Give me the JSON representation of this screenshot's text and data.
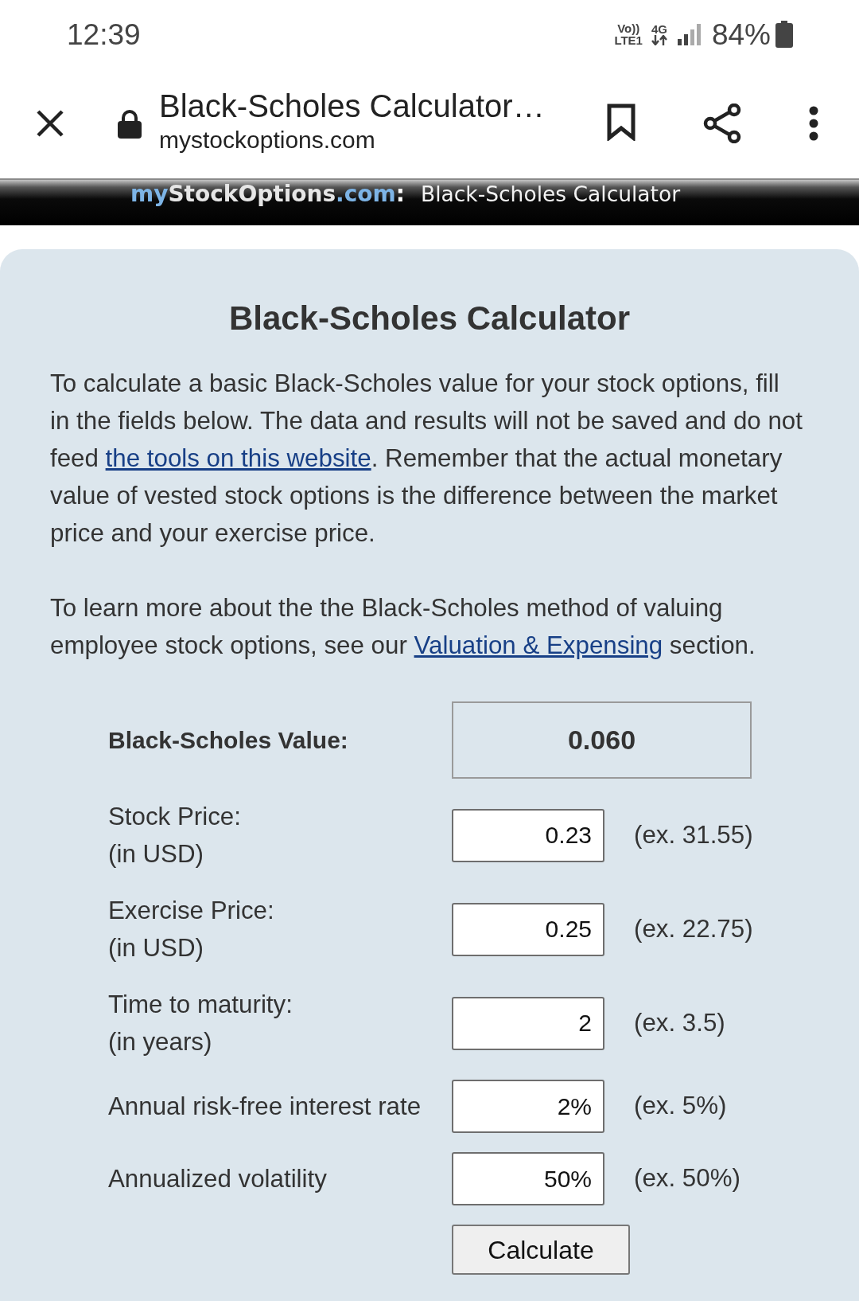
{
  "status_bar": {
    "time": "12:39",
    "voice_label": "Vo))",
    "network_label": "LTE1",
    "data_label": "4G",
    "battery": "84%"
  },
  "browser_bar": {
    "title": "Black-Scholes Calculator…",
    "url": "mystockoptions.com"
  },
  "banner": {
    "logo_parts": [
      {
        "text": "my",
        "color": "#7db4e6"
      },
      {
        "text": "StockOptions",
        "color": "#e6e6e6"
      },
      {
        "text": ".com",
        "color": "#7db4e6"
      },
      {
        "text": ":",
        "color": "#ffffff"
      }
    ],
    "title": "Black-Scholes Calculator"
  },
  "calculator": {
    "heading": "Black-Scholes Calculator",
    "paragraphs": [
      {
        "parts": [
          {
            "kind": "text",
            "text": "To calculate a basic Black-Scholes value for your stock options, fill in the fields below. The data and results will not be saved and do not feed "
          },
          {
            "kind": "link",
            "text": "the tools on this website"
          },
          {
            "kind": "text",
            "text": ". Remember that the actual monetary value of vested stock options is the difference between the market price and your exercise price."
          }
        ]
      },
      {
        "parts": [
          {
            "kind": "text",
            "text": "To learn more about the the Black-Scholes method of valuing employee stock options, see our "
          },
          {
            "kind": "link",
            "text": "Valuation & Expensing"
          },
          {
            "kind": "text",
            "text": " section."
          }
        ]
      }
    ],
    "result": {
      "label": "Black-Scholes Value:",
      "value": "0.060"
    },
    "fields": [
      {
        "label": "Stock Price:",
        "unit": "(in USD)",
        "value": "0.23",
        "example": "(ex. 31.55)"
      },
      {
        "label": "Exercise Price:",
        "unit": "(in USD)",
        "value": "0.25",
        "example": "(ex. 22.75)"
      },
      {
        "label": "Time to maturity:",
        "unit": "(in years)",
        "value": "2",
        "example": "(ex. 3.5)"
      },
      {
        "label": "Annual risk-free interest rate",
        "value": "2%",
        "example": "(ex. 5%)"
      },
      {
        "label": "Annualized volatility",
        "value": "50%",
        "example": "(ex. 50%)"
      }
    ],
    "button": "Calculate"
  }
}
